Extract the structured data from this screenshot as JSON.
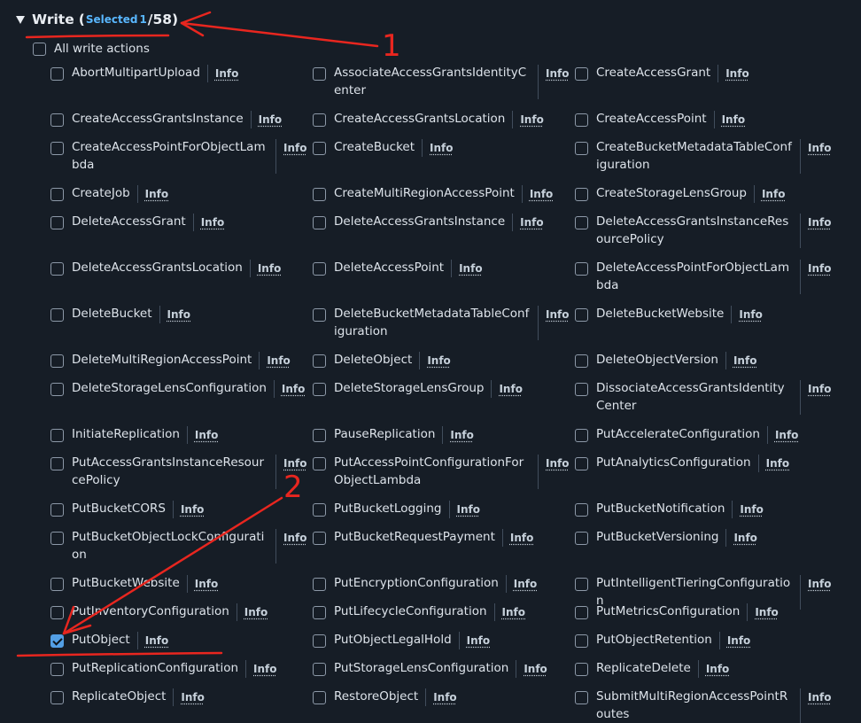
{
  "section": {
    "title": "Write",
    "selected_label": "Selected",
    "selected_count": "1",
    "total": "/58)",
    "open_paren": "(",
    "all_label": "All write actions",
    "info_label": "Info"
  },
  "actions": [
    [
      "AbortMultipartUpload",
      "AssociateAccessGrantsIdentityCenter",
      "CreateAccessGrant"
    ],
    [
      "CreateAccessGrantsInstance",
      "CreateAccessGrantsLocation",
      "CreateAccessPoint"
    ],
    [
      "CreateAccessPointForObjectLambda",
      "CreateBucket",
      "CreateBucketMetadataTableConfiguration"
    ],
    [
      "CreateJob",
      "CreateMultiRegionAccessPoint",
      "CreateStorageLensGroup"
    ],
    [
      "DeleteAccessGrant",
      "DeleteAccessGrantsInstance",
      "DeleteAccessGrantsInstanceResourcePolicy"
    ],
    [
      "DeleteAccessGrantsLocation",
      "DeleteAccessPoint",
      "DeleteAccessPointForObjectLambda"
    ],
    [
      "DeleteBucket",
      "DeleteBucketMetadataTableConfiguration",
      "DeleteBucketWebsite"
    ],
    [
      "DeleteMultiRegionAccessPoint",
      "DeleteObject",
      "DeleteObjectVersion"
    ],
    [
      "DeleteStorageLensConfiguration",
      "DeleteStorageLensGroup",
      "DissociateAccessGrantsIdentityCenter"
    ],
    [
      "InitiateReplication",
      "PauseReplication",
      "PutAccelerateConfiguration"
    ],
    [
      "PutAccessGrantsInstanceResourcePolicy",
      "PutAccessPointConfigurationForObjectLambda",
      "PutAnalyticsConfiguration"
    ],
    [
      "PutBucketCORS",
      "PutBucketLogging",
      "PutBucketNotification"
    ],
    [
      "PutBucketObjectLockConfiguration",
      "PutBucketRequestPayment",
      "PutBucketVersioning"
    ],
    [
      "PutBucketWebsite",
      "PutEncryptionConfiguration",
      "PutIntelligentTieringConfiguration"
    ],
    [
      "PutInventoryConfiguration",
      "PutLifecycleConfiguration",
      "PutMetricsConfiguration"
    ],
    [
      "PutObject",
      "PutObjectLegalHold",
      "PutObjectRetention"
    ],
    [
      "PutReplicationConfiguration",
      "PutStorageLensConfiguration",
      "ReplicateDelete"
    ],
    [
      "ReplicateObject",
      "RestoreObject",
      "SubmitMultiRegionAccessPointRoutes"
    ]
  ],
  "checked": [
    "PutObject"
  ],
  "annotations": {
    "marker_1": "1",
    "marker_2": "2",
    "color": "#e8261f"
  },
  "colors": {
    "background": "#161d26",
    "accent": "#539fe5",
    "selected_text": "#59b7ff"
  }
}
